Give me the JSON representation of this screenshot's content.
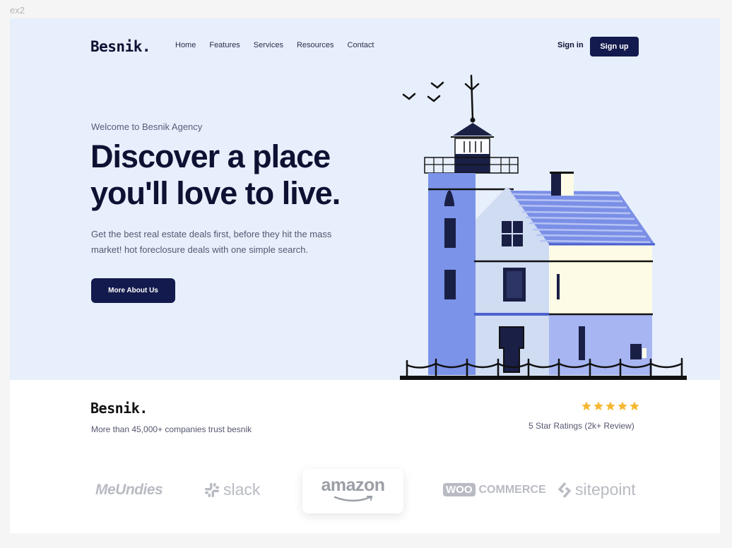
{
  "frame_label": "ex2",
  "header": {
    "logo": "Besnik.",
    "nav": [
      "Home",
      "Features",
      "Services",
      "Resources",
      "Contact"
    ],
    "signin": "Sign in",
    "signup": "Sign up"
  },
  "hero": {
    "welcome": "Welcome to Besnik Agency",
    "headline_line1": "Discover a place",
    "headline_line2": "you'll love to live.",
    "subtext": "Get the best real estate deals first, before they hit the mass market! hot foreclosure deals with one simple search.",
    "cta_label": "More About Us"
  },
  "trust": {
    "logo": "Besnik.",
    "text": "More than 45,000+ companies trust besnik",
    "stars": 5,
    "ratings_text": "5 Star Ratings (2k+ Review)"
  },
  "brands": [
    "MeUndies",
    "slack",
    "amazon",
    "WOO",
    "COMMERCE",
    "sitepoint"
  ],
  "colors": {
    "hero_bg": "#e7effc",
    "primary": "#131a4d",
    "star": "#f7b731",
    "lighthouse_blue": "#7b93e8"
  }
}
